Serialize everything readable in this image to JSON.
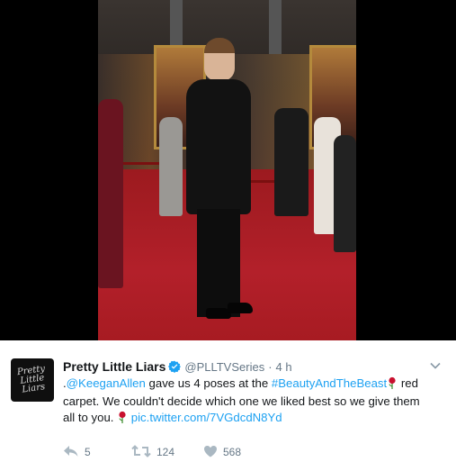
{
  "tweet": {
    "account": {
      "display_name": "Pretty Little Liars",
      "handle": "@PLLTVSeries",
      "avatar_text": "Pretty Little Liars"
    },
    "separator": "·",
    "time": "4 h",
    "text": {
      "prefix": ".",
      "mention": "@KeeganAllen",
      "part1": " gave us 4 poses at the ",
      "hashtag": "#BeautyAndTheBeast",
      "part2": "red carpet. We couldn't decide which one we liked best so we give them all to you. ",
      "link": "pic.twitter.com/7VGdcdN8Yd"
    },
    "actions": {
      "reply_count": "5",
      "retweet_count": "124",
      "like_count": "568"
    }
  },
  "colors": {
    "link": "#1da1f2",
    "verified": "#1da1f2",
    "meta": "#657786",
    "text": "#14171a"
  },
  "icons": [
    "verified-icon",
    "chevron-down-icon",
    "rose-icon",
    "reply-icon",
    "retweet-icon",
    "heart-icon"
  ]
}
